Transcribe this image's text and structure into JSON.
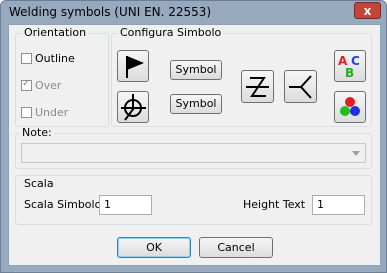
{
  "window": {
    "title": "Welding symbols (UNI EN. 22553)",
    "close_label": "x"
  },
  "orientation": {
    "title": "Orientation",
    "outline": {
      "label": "Outline",
      "checked": false
    },
    "over": {
      "label": "Over",
      "checked": true,
      "disabled": true
    },
    "under": {
      "label": "Under",
      "checked": false,
      "disabled": true
    }
  },
  "configura": {
    "title": "Configura Simbolo",
    "symbol_button_1": "Symbol",
    "symbol_button_2": "Symbol",
    "text_icon": {
      "a": "A",
      "b": "B",
      "c": "C"
    }
  },
  "note": {
    "title": "Note:",
    "value": ""
  },
  "scala": {
    "title": "Scala",
    "scala_simbolo_label": "Scala Simbolo",
    "scala_simbolo_value": "1",
    "height_text_label": "Height Text",
    "height_text_value": "1"
  },
  "footer": {
    "ok_label": "OK",
    "cancel_label": "Cancel"
  },
  "colors": {
    "accent": "#3c7fb1",
    "text_a": "#e02020",
    "text_b": "#20b020",
    "text_c": "#2040e0"
  }
}
